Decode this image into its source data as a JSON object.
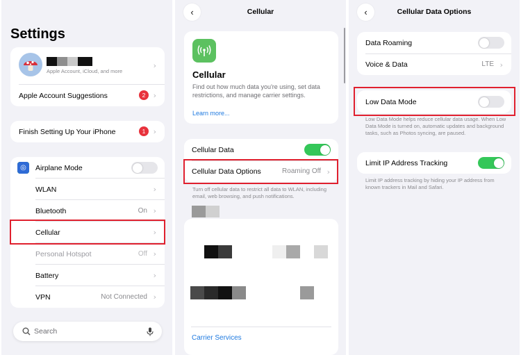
{
  "settings": {
    "title": "Settings",
    "account": {
      "subtitle": "Apple Account, iCloud, and more"
    },
    "suggestions": {
      "label": "Apple Account Suggestions",
      "badge": "2"
    },
    "finish": {
      "label": "Finish Setting Up Your iPhone",
      "badge": "1"
    },
    "items": [
      {
        "label": "Airplane Mode",
        "value": "",
        "icon": "airplane-icon",
        "color": "#f29b38"
      },
      {
        "label": "WLAN",
        "value": "",
        "icon": "wifi-icon",
        "color": "#3a82f7"
      },
      {
        "label": "Bluetooth",
        "value": "On",
        "icon": "bluetooth-icon",
        "color": "#3a82f7"
      },
      {
        "label": "Cellular",
        "value": "",
        "icon": "cellular-icon",
        "color": "#5cc160"
      },
      {
        "label": "Personal Hotspot",
        "value": "Off",
        "icon": "hotspot-icon",
        "color": "#5cc160"
      },
      {
        "label": "Battery",
        "value": "",
        "icon": "battery-icon",
        "color": "#5cc160"
      },
      {
        "label": "VPN",
        "value": "Not Connected",
        "icon": "vpn-icon",
        "color": "#2f6bd6"
      }
    ],
    "search_placeholder": "Search"
  },
  "cellular": {
    "nav_title": "Cellular",
    "header_title": "Cellular",
    "header_desc": "Find out how much data you're using, set data restrictions, and manage carrier settings.",
    "learn_more": "Learn more...",
    "data_label": "Cellular Data",
    "data_on": true,
    "options_label": "Cellular Data Options",
    "options_value": "Roaming Off",
    "footer": "Turn off cellular data to restrict all data to WLAN, including email, web browsing, and push notifications.",
    "carrier_services": "Carrier Services"
  },
  "options": {
    "nav_title": "Cellular Data Options",
    "roaming_label": "Data Roaming",
    "roaming_on": false,
    "voice_label": "Voice & Data",
    "voice_value": "LTE",
    "low_data_label": "Low Data Mode",
    "low_data_on": false,
    "low_data_footer": "Low Data Mode helps reduce cellular data usage. When Low Data Mode is turned on, automatic updates and background tasks, such as Photos syncing, are paused.",
    "limit_ip_label": "Limit IP Address Tracking",
    "limit_ip_on": true,
    "limit_ip_footer": "Limit IP address tracking by hiding your IP address from known trackers in Mail and Safari."
  },
  "colors": {
    "accent": "#1f7ae0",
    "highlight": "#e0202e",
    "toggle_on": "#34c759"
  }
}
